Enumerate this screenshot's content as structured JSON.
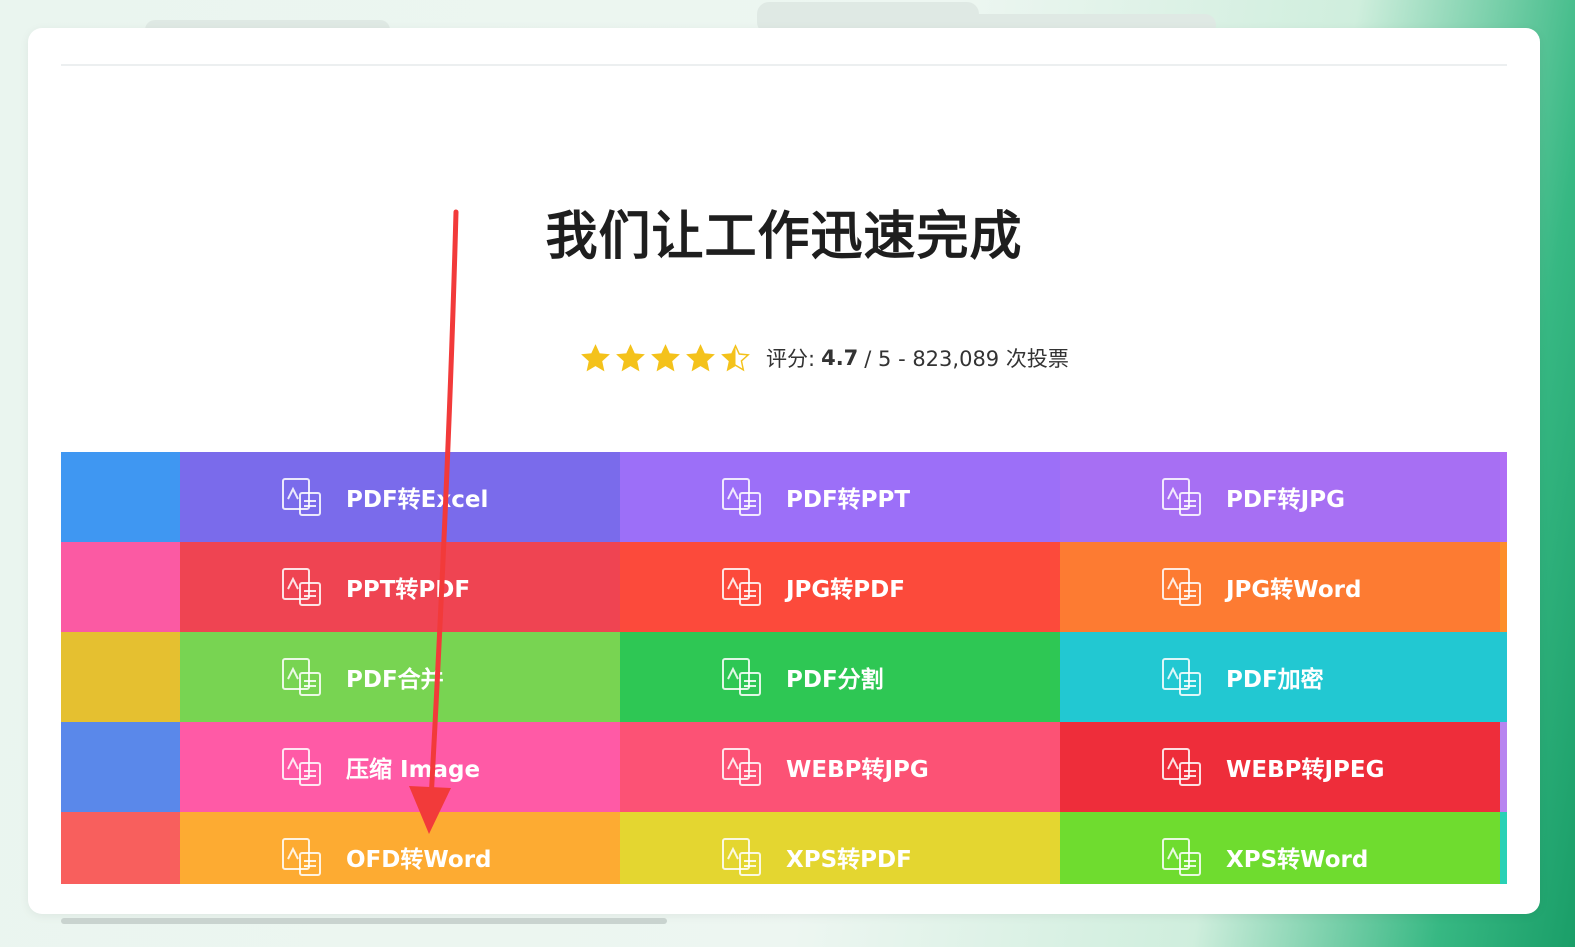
{
  "hero": {
    "title": "我们让工作迅速完成"
  },
  "rating": {
    "stars": 4.5,
    "prefix": "评分:",
    "score": "4.7",
    "rest": "/ 5 - 823,089 次投票",
    "star_color": "#f4c21b"
  },
  "tools": [
    {
      "row": 1,
      "edge_left": "#3f97f2",
      "edge_right": "#b06ef5",
      "items": [
        {
          "label": "PDF转Excel",
          "icon": "pdf-to-excel-icon",
          "color": "#7a6beb"
        },
        {
          "label": "PDF转PPT",
          "icon": "pdf-to-ppt-icon",
          "color": "#9c6ff8"
        },
        {
          "label": "PDF转JPG",
          "icon": "pdf-to-jpg-icon",
          "color": "#a76ff3"
        }
      ]
    },
    {
      "row": 2,
      "edge_left": "#fb5aa3",
      "edge_right": "#fd8e2b",
      "items": [
        {
          "label": "PPT转PDF",
          "icon": "ppt-to-pdf-icon",
          "color": "#ef4452"
        },
        {
          "label": "JPG转PDF",
          "icon": "jpg-to-pdf-icon",
          "color": "#fc4a3b"
        },
        {
          "label": "JPG转Word",
          "icon": "jpg-to-word-icon",
          "color": "#fd7b32"
        }
      ]
    },
    {
      "row": 3,
      "edge_left": "#e5c030",
      "edge_right": "#23c5d1",
      "items": [
        {
          "label": "PDF合并",
          "icon": "pdf-merge-icon",
          "color": "#78d452"
        },
        {
          "label": "PDF分割",
          "icon": "pdf-split-icon",
          "color": "#2ec754"
        },
        {
          "label": "PDF加密",
          "icon": "pdf-encrypt-icon",
          "color": "#22c8d2"
        }
      ]
    },
    {
      "row": 4,
      "edge_left": "#5a88ea",
      "edge_right": "#b784f0",
      "items": [
        {
          "label": "压缩 Image",
          "icon": "compress-image-icon",
          "color": "#ff5aa6"
        },
        {
          "label": "WEBP转JPG",
          "icon": "webp-to-jpg-icon",
          "color": "#fc5275"
        },
        {
          "label": "WEBP转JPEG",
          "icon": "webp-to-jpeg-icon",
          "color": "#ee2d3a"
        }
      ]
    },
    {
      "row": 5,
      "edge_left": "#f85f5d",
      "edge_right": "#29d1b5",
      "items": [
        {
          "label": "OFD转Word",
          "icon": "ofd-to-word-icon",
          "color": "#fdab32"
        },
        {
          "label": "XPS转PDF",
          "icon": "xps-to-pdf-icon",
          "color": "#e4d630"
        },
        {
          "label": "XPS转Word",
          "icon": "xps-to-word-icon",
          "color": "#6fdc2f"
        }
      ]
    }
  ],
  "annotation": {
    "arrow_color": "#f23a3a"
  }
}
